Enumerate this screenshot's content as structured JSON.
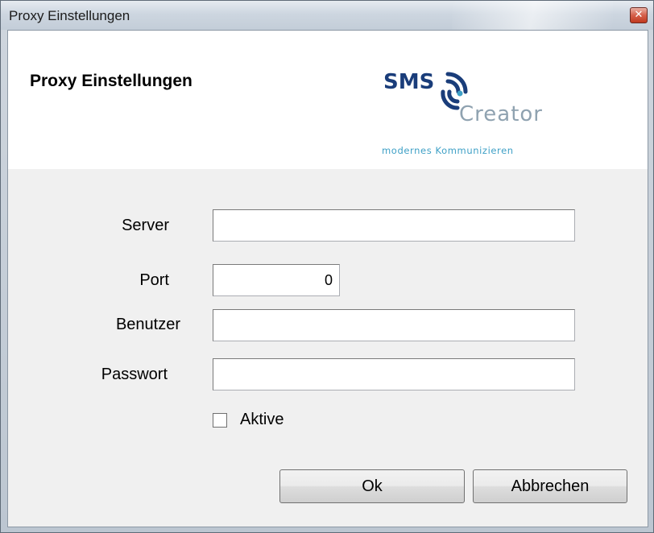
{
  "window": {
    "title": "Proxy Einstellungen"
  },
  "header": {
    "title": "Proxy Einstellungen",
    "logo": {
      "brand_top": "SMS",
      "brand_bottom": "Creator",
      "tagline": "modernes Kommunizieren",
      "colors": {
        "dark": "#1a3d7a",
        "light": "#3ea0c6"
      }
    }
  },
  "form": {
    "server": {
      "label": "Server",
      "value": ""
    },
    "port": {
      "label": "Port",
      "value": "0"
    },
    "user": {
      "label": "Benutzer",
      "value": ""
    },
    "password": {
      "label": "Passwort",
      "value": ""
    },
    "active": {
      "label": "Aktive",
      "checked": false
    }
  },
  "buttons": {
    "ok_label": "Ok",
    "cancel_label": "Abbrechen"
  },
  "icons": {
    "close": "close-icon"
  }
}
